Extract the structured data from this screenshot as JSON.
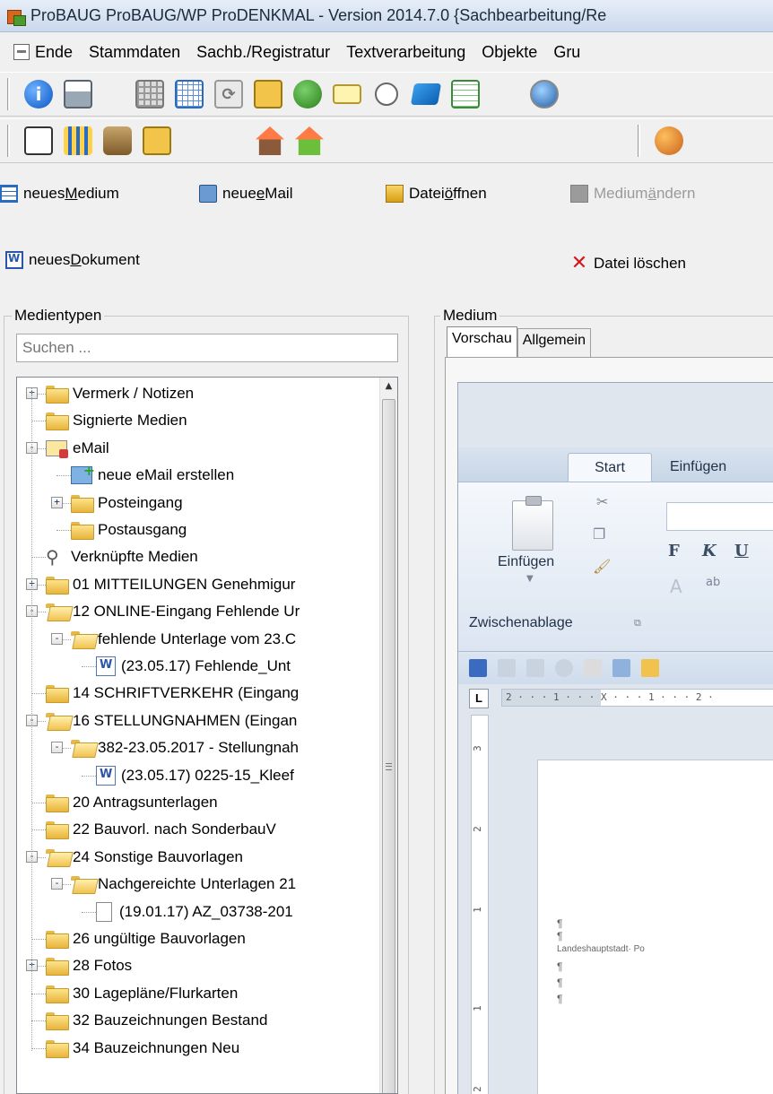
{
  "window": {
    "title": "ProBAUG ProBAUG/WP ProDENKMAL  - Version 2014.7.0 {Sachbearbeitung/Re"
  },
  "menu": {
    "items": [
      "Ende",
      "Stammdaten",
      "Sachb./Registratur",
      "Textverarbeitung",
      "Objekte",
      "Gru"
    ]
  },
  "actions": {
    "new_medium": {
      "prefix": "neues ",
      "accel": "M",
      "rest": "edium"
    },
    "new_email": {
      "prefix": "neue ",
      "accel": "e",
      "rest": "Mail"
    },
    "open_file": {
      "prefix": "Datei ",
      "accel": "ö",
      "rest": "ffnen"
    },
    "change_medium": {
      "prefix": "Medium ",
      "accel": "ä",
      "rest": "ndern"
    },
    "new_document": {
      "prefix": "neues ",
      "accel": "D",
      "rest": "okument"
    },
    "delete_file": {
      "label": "Datei löschen"
    }
  },
  "media_types": {
    "legend": "Medientypen",
    "search_placeholder": "Suchen ...",
    "tree": [
      {
        "label": "Vermerk / Notizen",
        "icon": "folder",
        "depth": 0,
        "expander": "+"
      },
      {
        "label": "Signierte Medien",
        "icon": "folder",
        "depth": 0,
        "expander": ""
      },
      {
        "label": "eMail",
        "icon": "email",
        "depth": 0,
        "expander": "-"
      },
      {
        "label": "neue eMail erstellen",
        "icon": "new-email",
        "depth": 1,
        "expander": ""
      },
      {
        "label": "Posteingang",
        "icon": "folder",
        "depth": 1,
        "expander": "+"
      },
      {
        "label": "Postausgang",
        "icon": "folder",
        "depth": 1,
        "expander": ""
      },
      {
        "label": "Verknüpfte Medien",
        "icon": "link",
        "depth": 0,
        "expander": ""
      },
      {
        "label": "01 MITTEILUNGEN Genehmigur",
        "icon": "folder",
        "depth": 0,
        "expander": "+"
      },
      {
        "label": "12 ONLINE-Eingang Fehlende Ur",
        "icon": "folder-open",
        "depth": 0,
        "expander": "-"
      },
      {
        "label": "fehlende Unterlage  vom 23.C",
        "icon": "folder-open",
        "depth": 1,
        "expander": "-"
      },
      {
        "label": "(23.05.17) Fehlende_Unt",
        "icon": "word-doc",
        "depth": 2,
        "expander": ""
      },
      {
        "label": "14 SCHRIFTVERKEHR (Eingang",
        "icon": "folder",
        "depth": 0,
        "expander": ""
      },
      {
        "label": "16 STELLUNGNAHMEN (Eingan",
        "icon": "folder-open",
        "depth": 0,
        "expander": "-"
      },
      {
        "label": "382-23.05.2017 - Stellungnah",
        "icon": "folder-open",
        "depth": 1,
        "expander": "-"
      },
      {
        "label": "(23.05.17) 0225-15_Kleef",
        "icon": "word-doc",
        "depth": 2,
        "expander": ""
      },
      {
        "label": "20 Antragsunterlagen",
        "icon": "folder",
        "depth": 0,
        "expander": ""
      },
      {
        "label": "22  Bauvorl. nach SonderbauV",
        "icon": "folder",
        "depth": 0,
        "expander": ""
      },
      {
        "label": "24 Sonstige Bauvorlagen",
        "icon": "folder-open",
        "depth": 0,
        "expander": "-"
      },
      {
        "label": "Nachgereichte Unterlagen 21",
        "icon": "folder-open",
        "depth": 1,
        "expander": "-"
      },
      {
        "label": "(19.01.17) AZ_03738-201",
        "icon": "blank-doc",
        "depth": 2,
        "expander": ""
      },
      {
        "label": "26 ungültige Bauvorlagen",
        "icon": "folder",
        "depth": 0,
        "expander": ""
      },
      {
        "label": "28 Fotos",
        "icon": "folder",
        "depth": 0,
        "expander": "+"
      },
      {
        "label": "30 Lagepläne/Flurkarten",
        "icon": "folder",
        "depth": 0,
        "expander": ""
      },
      {
        "label": "32 Bauzeichnungen Bestand",
        "icon": "folder",
        "depth": 0,
        "expander": ""
      },
      {
        "label": "34 Bauzeichnungen Neu",
        "icon": "folder",
        "depth": 0,
        "expander": ""
      }
    ]
  },
  "medium": {
    "legend": "Medium",
    "tabs": [
      "Vorschau",
      "Allgemein"
    ],
    "active_tab": "Vorschau"
  },
  "word_preview": {
    "ribbon_tabs": [
      "Start",
      "Einfügen"
    ],
    "paste_label": "Einfügen",
    "clipboard_group": "Zwischenablage",
    "format_buttons": [
      "F",
      "K",
      "U"
    ],
    "ruler_letter": "L",
    "ruler_marks": "2 · · · 1 · · · X · · · 1 · · · 2 ·",
    "vruler_marks": [
      "3",
      "2",
      "1",
      "1",
      "2"
    ],
    "pilcrow": "¶",
    "doc_text": "Landeshauptstadt· Po"
  }
}
